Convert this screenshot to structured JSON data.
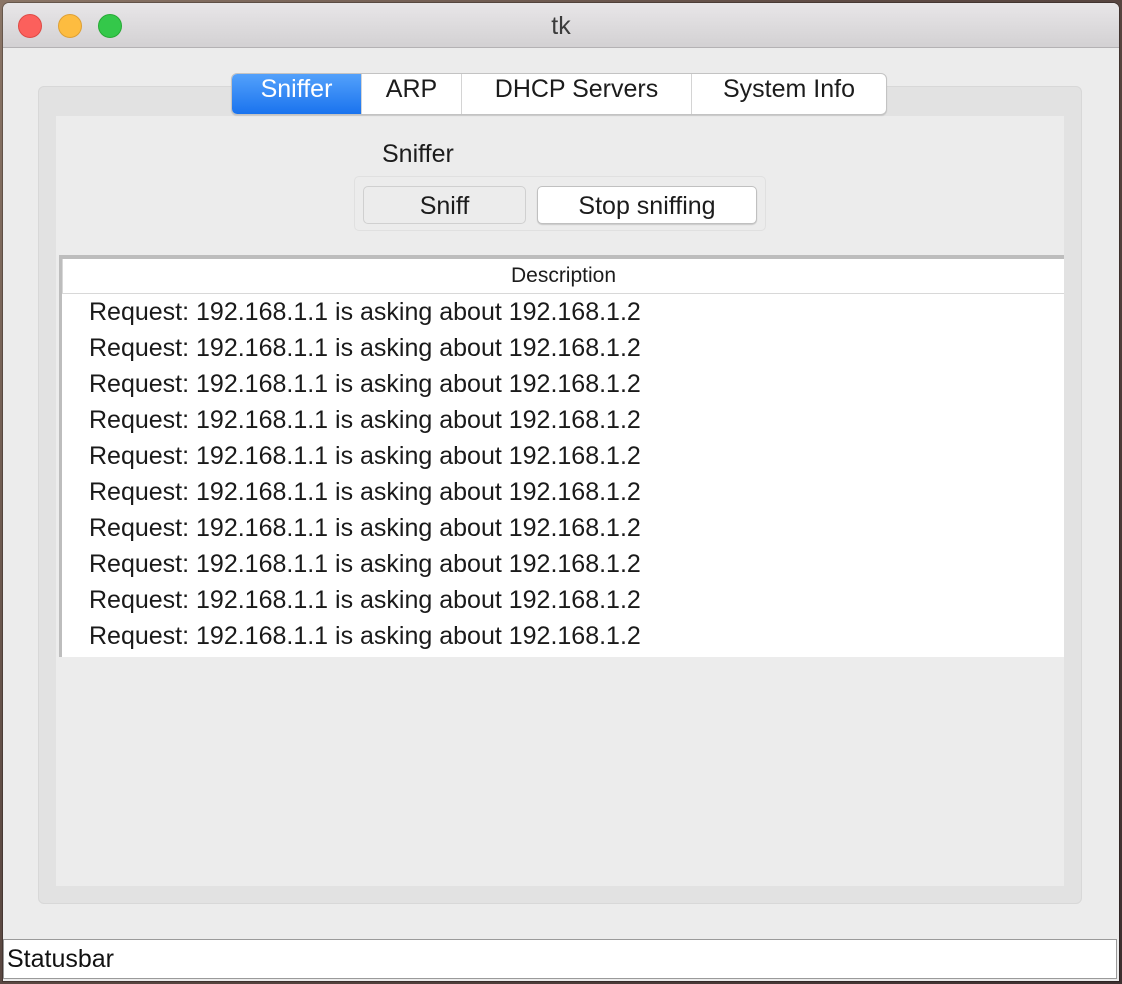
{
  "window": {
    "title": "tk"
  },
  "tabs": [
    {
      "label": "Sniffer",
      "active": true
    },
    {
      "label": "ARP",
      "active": false
    },
    {
      "label": "DHCP Servers",
      "active": false
    },
    {
      "label": "System Info",
      "active": false
    }
  ],
  "sniffer": {
    "section_label": "Sniffer",
    "sniff_button": "Sniff",
    "stop_button": "Stop sniffing",
    "table": {
      "header": "Description",
      "rows": [
        "Request: 192.168.1.1 is asking about 192.168.1.2",
        "Request: 192.168.1.1 is asking about 192.168.1.2",
        "Request: 192.168.1.1 is asking about 192.168.1.2",
        "Request: 192.168.1.1 is asking about 192.168.1.2",
        "Request: 192.168.1.1 is asking about 192.168.1.2",
        "Request: 192.168.1.1 is asking about 192.168.1.2",
        "Request: 192.168.1.1 is asking about 192.168.1.2",
        "Request: 192.168.1.1 is asking about 192.168.1.2",
        "Request: 192.168.1.1 is asking about 192.168.1.2",
        "Request: 192.168.1.1 is asking about 192.168.1.2"
      ]
    }
  },
  "statusbar": {
    "text": "Statusbar"
  },
  "colors": {
    "active_tab": "#1a73ee",
    "close": "#fc605c",
    "minimize": "#fdbc40",
    "maximize": "#34c84a"
  }
}
